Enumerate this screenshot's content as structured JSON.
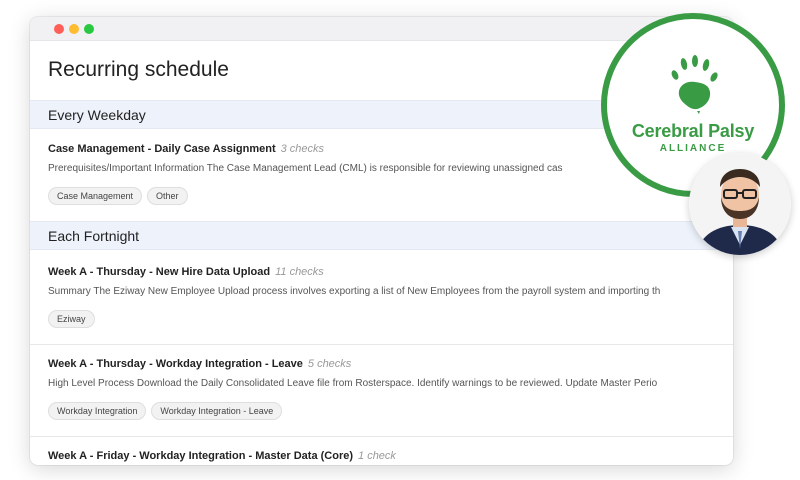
{
  "page_title": "Recurring schedule",
  "sections": [
    {
      "heading": "Every Weekday",
      "items": [
        {
          "title": "Case Management - Daily Case Assignment",
          "checks": "3 checks",
          "description": "Prerequisites/Important Information The Case Management Lead (CML) is responsible for reviewing unassigned cas",
          "tags": [
            "Case Management",
            "Other"
          ]
        }
      ]
    },
    {
      "heading": "Each Fortnight",
      "items": [
        {
          "title": "Week A - Thursday - New Hire Data Upload",
          "checks": "11 checks",
          "description": "Summary The Eziway New Employee Upload process involves exporting a list of New Employees from the payroll system and importing th",
          "tags": [
            "Eziway"
          ]
        },
        {
          "title": "Week A - Thursday - Workday Integration - Leave",
          "checks": "5 checks",
          "description": "High Level Process Download the Daily Consolidated Leave file from Rosterspace. Identify warnings to be reviewed. Update Master Perio",
          "tags": [
            "Workday Integration",
            "Workday Integration - Leave"
          ]
        },
        {
          "title": "Week A - Friday - Workday Integration - Master Data (Core)",
          "checks": "1 check",
          "description": "",
          "tags": []
        }
      ]
    }
  ],
  "logo": {
    "brand": "Cerebral Palsy",
    "subtitle": "ALLIANCE",
    "icon": "hand-and-australia-icon",
    "color": "#3a9b45"
  },
  "avatar": {
    "icon": "person-portrait-icon"
  }
}
